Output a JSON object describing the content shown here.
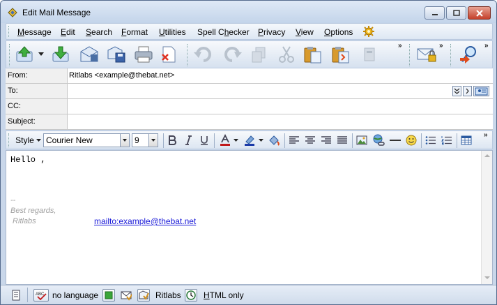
{
  "window": {
    "title": "Edit Mail Message"
  },
  "menu": {
    "items": [
      {
        "label": "Message",
        "accel": "M",
        "rest": "essage"
      },
      {
        "label": "Edit",
        "accel": "E",
        "rest": "dit"
      },
      {
        "label": "Search",
        "accel": "S",
        "rest": "earch"
      },
      {
        "label": "Format",
        "accel": "F",
        "rest": "ormat"
      },
      {
        "label": "Utilities",
        "accel": "U",
        "rest": "tilities"
      },
      {
        "label": "Spell Checker",
        "pre": "Spell C",
        "accel": "h",
        "rest": "ecker"
      },
      {
        "label": "Privacy",
        "accel": "P",
        "rest": "rivacy"
      },
      {
        "label": "View",
        "accel": "V",
        "rest": "iew"
      },
      {
        "label": "Options",
        "accel": "O",
        "rest": "ptions"
      }
    ]
  },
  "toolbar": {
    "icons": [
      "send-queue-icon",
      "put-to-outbox-icon",
      "save-draft-icon",
      "save-to-file-icon",
      "print-icon",
      "discard-icon",
      "undo-icon",
      "redo-icon",
      "copy-icon",
      "cut-icon",
      "paste-icon",
      "paste-quoted-icon",
      "clear-icon",
      "secure-mail-icon",
      "address-book-search-icon"
    ],
    "overflow": "»"
  },
  "header": {
    "from_label": "From:",
    "from_value": "Ritlabs <example@thebat.net>",
    "to_label": "To:",
    "to_value": "",
    "cc_label": "CC:",
    "cc_value": "",
    "subject_label": "Subject:",
    "subject_value": ""
  },
  "format": {
    "style_label": "Style",
    "font": "Courier New",
    "size": "9",
    "overflow": "»"
  },
  "editor": {
    "greeting": "Hello ,",
    "sig_dashes": "--",
    "sig_regards": "Best regards,",
    "sig_name": " Ritlabs",
    "mailto": "mailto:example@thebat.net"
  },
  "status": {
    "language": "no language",
    "account": "Ritlabs",
    "mode_accel": "H",
    "mode_rest": "TML only"
  },
  "colors": {
    "accent": "#c9d7ea",
    "link": "#1a1ad8",
    "signature": "#a0a0a0"
  }
}
